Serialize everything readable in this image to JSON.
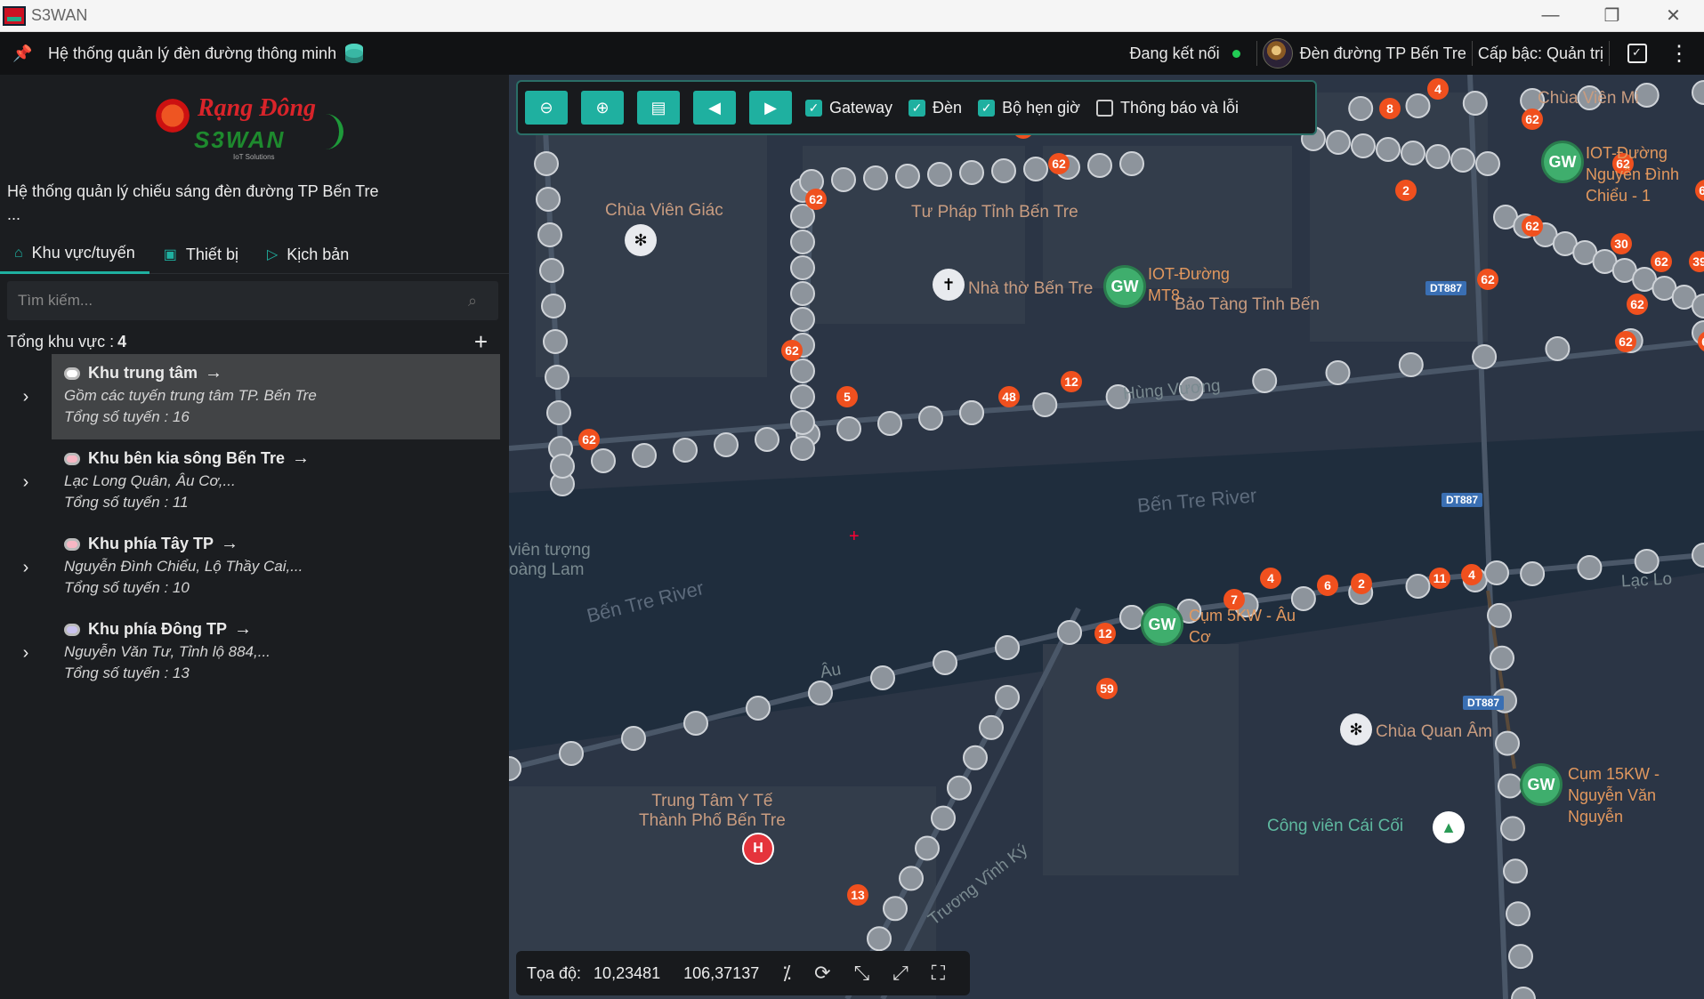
{
  "window": {
    "title": "S3WAN",
    "minimize": "—",
    "restore": "❐",
    "close": "✕"
  },
  "topbar": {
    "system_title": "Hệ thống quản lý đèn đường thông minh",
    "connection_status": "Đang kết nối",
    "organization": "Đèn đường TP Bến Tre",
    "role": "Cấp bậc: Quản trị",
    "pin_icon": "pin-icon",
    "kebab": "⋮"
  },
  "sidebar": {
    "logo_brand": "Rạng Đông",
    "logo_product": "S3WAN",
    "logo_tagline": "IoT Solutions",
    "description": "Hệ thống quản lý chiếu sáng đèn đường TP Bến Tre",
    "description_more": "...",
    "tabs": [
      {
        "label": "Khu vực/tuyến",
        "icon": "home-icon"
      },
      {
        "label": "Thiết bị",
        "icon": "device-icon"
      },
      {
        "label": "Kịch bản",
        "icon": "script-icon"
      }
    ],
    "search_placeholder": "Tìm kiếm...",
    "total_label": "Tổng khu vực :",
    "total_count": "4",
    "areas": [
      {
        "name": "Khu trung tâm",
        "desc": "Gồm các tuyến trung tâm TP. Bến Tre",
        "count": "Tổng số tuyến : 16",
        "selected": true
      },
      {
        "name": "Khu bên kia sông Bến Tre",
        "desc": "Lạc Long Quân, Âu Cơ,...",
        "count": "Tổng số tuyến : 11",
        "selected": false
      },
      {
        "name": "Khu phía Tây TP",
        "desc": "Nguyễn Đình Chiểu, Lộ Thầy Cai,...",
        "count": "Tổng số tuyến : 10",
        "selected": false
      },
      {
        "name": "Khu phía Đông TP",
        "desc": "Nguyễn Văn Tư, Tỉnh lộ 884,...",
        "count": "Tổng số tuyến : 13",
        "selected": false
      }
    ]
  },
  "map": {
    "toolbar": {
      "buttons": [
        "zoom-out-icon",
        "zoom-in-icon",
        "contact-card-icon",
        "history-back-icon",
        "history-forward-icon"
      ],
      "checkboxes": [
        {
          "label": "Gateway",
          "checked": true
        },
        {
          "label": "Đèn",
          "checked": true
        },
        {
          "label": "Bộ hẹn giờ",
          "checked": true
        },
        {
          "label": "Thông báo và lỗi",
          "checked": false
        }
      ]
    },
    "coords": {
      "label": "Tọa độ:",
      "lat": "10,23481",
      "lng": "106,37137"
    },
    "labels": {
      "chua_vien_giac": "Chùa Viên Giác",
      "tu_phap": "Tư Pháp Tỉnh Bến Tre",
      "nha_tho": "Nhà thờ Bến Tre",
      "bao_tang": "Bảo Tàng Tỉnh Bến",
      "iot_duong_top": "IOT-Đường",
      "iot_duong_top2": "MT8",
      "river1": "Bến Tre River",
      "river2": "Bến Tre River",
      "cong_vien_tuong": "viên tượng",
      "cong_vien_tuong2": "oàng Lam",
      "chua_quan_am": "Chùa Quan Âm",
      "cong_vien_cai_coi": "Công viên Cái Cối",
      "trung_tam_yte1": "Trung Tâm Y Tế",
      "trung_tam_yte2": "Thành Phố Bến Tre",
      "au_road": "Âu",
      "chua_vien_minh": "Chùa Viên Mi",
      "truong_vinh_ky": "Trương Vĩnh Ký",
      "hung_vuong": "Hùng Vương",
      "lac_long_quan": "Lạc Lo"
    },
    "gateways": [
      {
        "badge": "GW",
        "label": [
          "IOT-Đường",
          "Nguyễn Đình",
          "Chiểu - 1"
        ]
      },
      {
        "badge": "GW",
        "label": [
          "Cụm 5KW - Âu",
          "Cơ"
        ]
      },
      {
        "badge": "GW",
        "label": [
          "Cụm 15KW -",
          "Nguyễn Văn",
          "Nguyễn"
        ]
      },
      {
        "badge": "GW",
        "label": []
      }
    ],
    "road_tags": [
      "DT887",
      "DT887",
      "DT887"
    ],
    "alert_badges": [
      "62",
      "62",
      "62",
      "62",
      "62",
      "62",
      "62",
      "62",
      "62",
      "62",
      "62",
      "62",
      "62",
      "62",
      "48",
      "12",
      "5",
      "30",
      "39",
      "4",
      "8",
      "2",
      "7",
      "4",
      "6",
      "2",
      "11",
      "4",
      "12",
      "59",
      "13"
    ],
    "colors": {
      "accent": "#1fb0a0",
      "alert": "#f0501e",
      "gateway": "#3fae6d",
      "water": "#1f2d3d"
    }
  }
}
